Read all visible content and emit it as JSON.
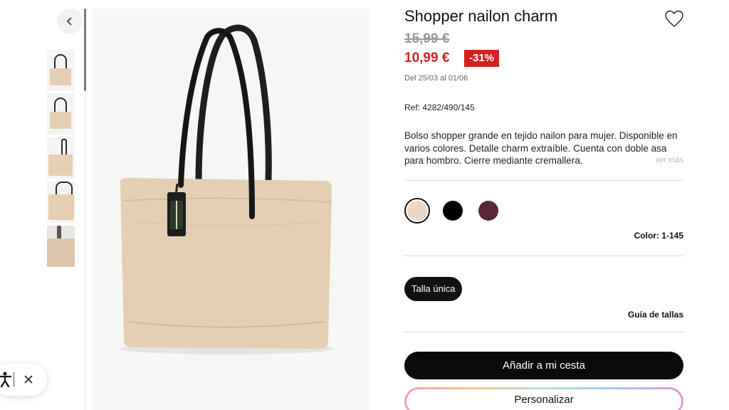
{
  "gallery": {
    "thumbnail_count": 5
  },
  "product": {
    "title": "Shopper nailon charm",
    "old_price": "15,99 €",
    "new_price": "10,99 €",
    "discount": "-31%",
    "date_range": "Del 25/03 al 01/06",
    "ref": "Ref: 4282/490/145",
    "description": "Bolso shopper grande en tejido nailon para mujer. Disponible en varios colores. Detalle charm extraíble. Cuenta con doble asa para hombro. Cierre mediante cremallera.",
    "see_more": "ver más"
  },
  "colors": {
    "swatches": [
      {
        "name": "beige",
        "hex": "#ecd6c6",
        "selected": true
      },
      {
        "name": "black",
        "hex": "#000000",
        "selected": false
      },
      {
        "name": "burgundy",
        "hex": "#5a2635",
        "selected": false
      }
    ],
    "label": "Color: 1-145"
  },
  "sizes": {
    "selected": "Talla única",
    "guide_label": "Guía de tallas"
  },
  "actions": {
    "add_to_cart": "Añadir a mi cesta",
    "personalize": "Personalizar"
  },
  "theme": {
    "sale_red": "#d0231f",
    "bag_color": "#e5cfb3"
  }
}
